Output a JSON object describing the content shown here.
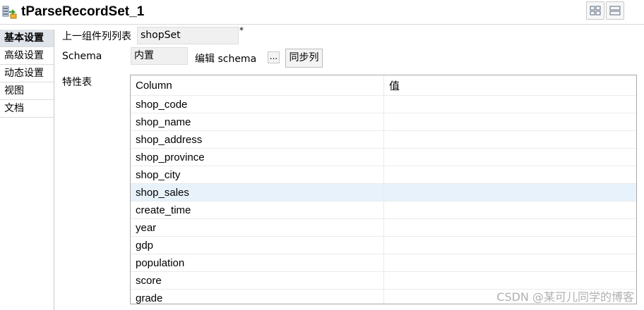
{
  "header": {
    "title": "tParseRecordSet_1",
    "icon": "component-icon"
  },
  "sidebar": {
    "items": [
      {
        "label": "基本设置",
        "active": true
      },
      {
        "label": "高级设置",
        "active": false
      },
      {
        "label": "动态设置",
        "active": false
      },
      {
        "label": "视图",
        "active": false
      },
      {
        "label": "文档",
        "active": false
      }
    ]
  },
  "form": {
    "prev_list_label": "上一组件列列表",
    "prev_list_value": "shopSet",
    "required_mark": "*",
    "schema_label": "Schema",
    "schema_value": "内置",
    "edit_schema_label": "编辑 schema",
    "edit_schema_button": "...",
    "sync_button": "同步列",
    "attr_table_label": "特性表"
  },
  "table": {
    "headers": [
      "Column",
      "值"
    ],
    "rows": [
      {
        "column": "shop_code",
        "value": ""
      },
      {
        "column": "shop_name",
        "value": ""
      },
      {
        "column": "shop_address",
        "value": ""
      },
      {
        "column": "shop_province",
        "value": ""
      },
      {
        "column": "shop_city",
        "value": ""
      },
      {
        "column": "shop_sales",
        "value": ""
      },
      {
        "column": "create_time",
        "value": ""
      },
      {
        "column": "year",
        "value": ""
      },
      {
        "column": "gdp",
        "value": ""
      },
      {
        "column": "population",
        "value": ""
      },
      {
        "column": "score",
        "value": ""
      },
      {
        "column": "grade",
        "value": ""
      }
    ],
    "highlight_color": "#e8f2fb"
  },
  "watermark": "CSDN @某可儿同学的博客"
}
